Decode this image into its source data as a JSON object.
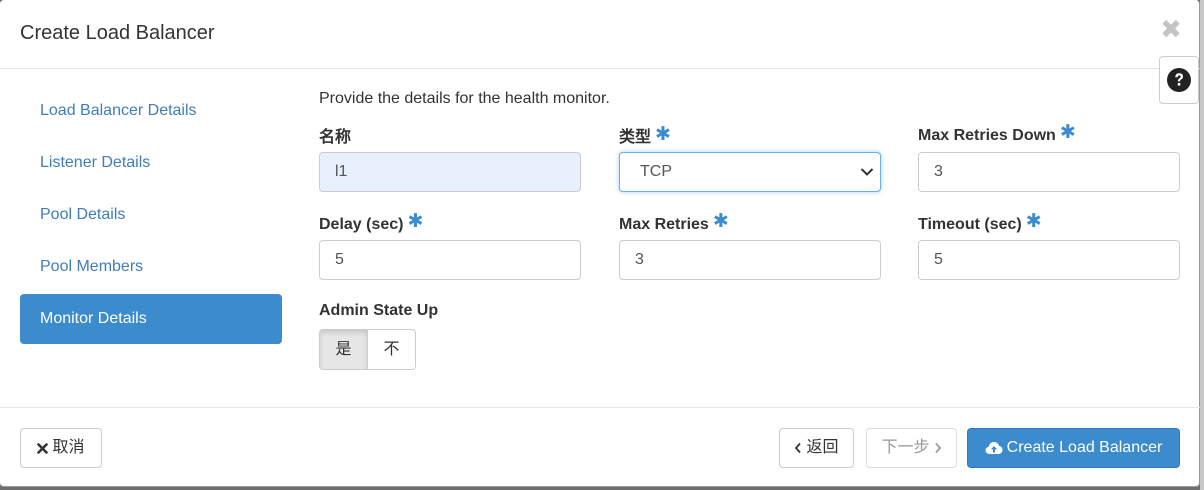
{
  "modal": {
    "title": "Create Load Balancer",
    "close_glyph": "✖"
  },
  "sidebar": {
    "items": [
      {
        "label": "Load Balancer Details",
        "active": false
      },
      {
        "label": "Listener Details",
        "active": false
      },
      {
        "label": "Pool Details",
        "active": false
      },
      {
        "label": "Pool Members",
        "active": false
      },
      {
        "label": "Monitor Details",
        "active": true
      }
    ]
  },
  "form": {
    "intro": "Provide the details for the health monitor.",
    "name": {
      "label": "名称",
      "value": "l1"
    },
    "type": {
      "label": "类型",
      "value": "TCP",
      "required": true
    },
    "max_retries_down": {
      "label": "Max Retries Down",
      "value": "3",
      "required": true
    },
    "delay": {
      "label": "Delay (sec)",
      "value": "5",
      "required": true
    },
    "max_retries": {
      "label": "Max Retries",
      "value": "3",
      "required": true
    },
    "timeout": {
      "label": "Timeout (sec)",
      "value": "5",
      "required": true
    },
    "admin_state": {
      "label": "Admin State Up",
      "yes": "是",
      "no": "不",
      "selected": "是"
    }
  },
  "footer": {
    "cancel": "取消",
    "back": "返回",
    "next": "下一步",
    "create": "Create Load Balancer"
  },
  "colors": {
    "accent": "#3b8bcd",
    "link": "#3f7db8",
    "required_star": "#3b8bcd"
  },
  "icons": {
    "close": "close-icon",
    "help": "question-circle-icon",
    "cancel": "times-icon",
    "back": "chevron-left-icon",
    "next": "chevron-right-icon",
    "create": "cloud-upload-icon",
    "select": "chevron-down-icon",
    "required": "asterisk-icon"
  }
}
